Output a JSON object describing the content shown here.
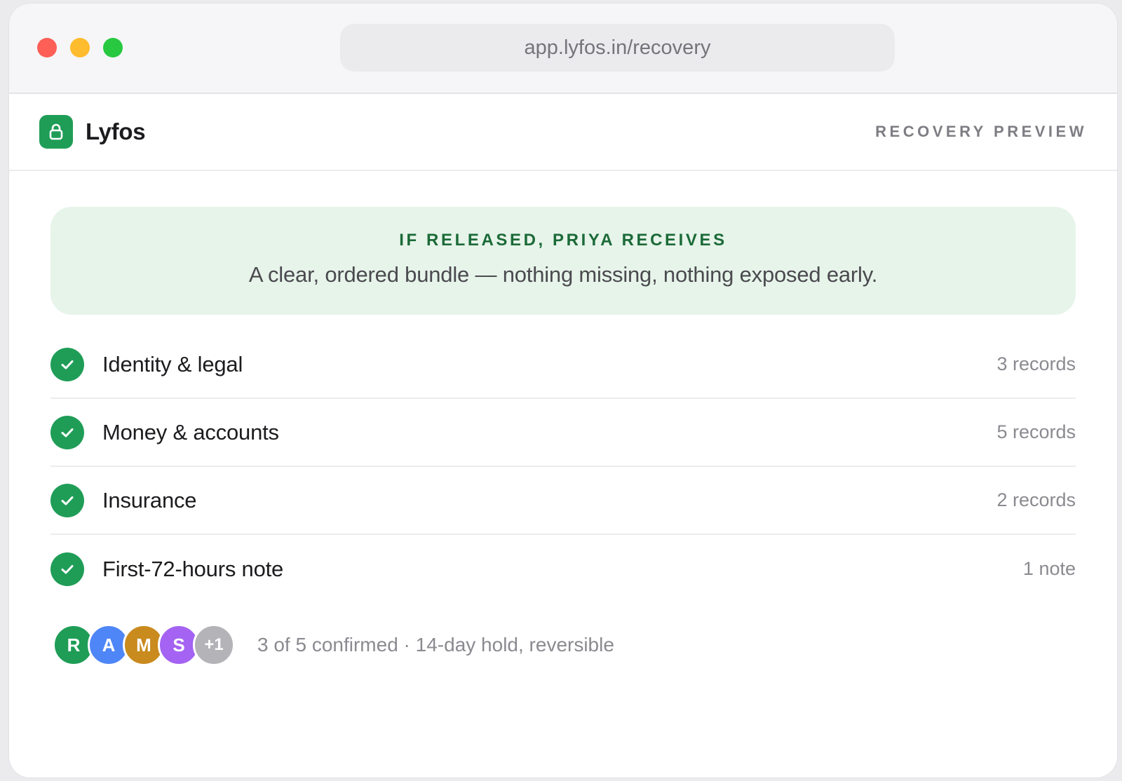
{
  "browser": {
    "url": "app.lyfos.in/recovery"
  },
  "app": {
    "brand_name": "Lyfos",
    "brand_icon": "lock-icon",
    "brand_color": "#1f9d57",
    "preview_label": "RECOVERY PREVIEW"
  },
  "banner": {
    "title": "IF RELEASED, PRIYA RECEIVES",
    "text": "A clear, ordered bundle — nothing missing, nothing exposed early.",
    "background": "#e7f4ea",
    "title_color": "#1b6a38"
  },
  "bundle_items": [
    {
      "label": "Identity & legal",
      "count": "3 records",
      "status_icon": "check-circle-icon"
    },
    {
      "label": "Money & accounts",
      "count": "5 records",
      "status_icon": "check-circle-icon"
    },
    {
      "label": "Insurance",
      "count": "2 records",
      "status_icon": "check-circle-icon"
    },
    {
      "label": "First-72-hours note",
      "count": "1 note",
      "status_icon": "check-circle-icon"
    }
  ],
  "confirmers": {
    "avatars": [
      {
        "initial": "R",
        "color": "#1f9d57"
      },
      {
        "initial": "A",
        "color": "#4f86f7"
      },
      {
        "initial": "M",
        "color": "#c98a1e"
      },
      {
        "initial": "S",
        "color": "#a463f2"
      },
      {
        "initial": "+1",
        "color": "#b3b3b8"
      }
    ],
    "status_text": "3 of 5 confirmed · 14-day hold, reversible"
  }
}
